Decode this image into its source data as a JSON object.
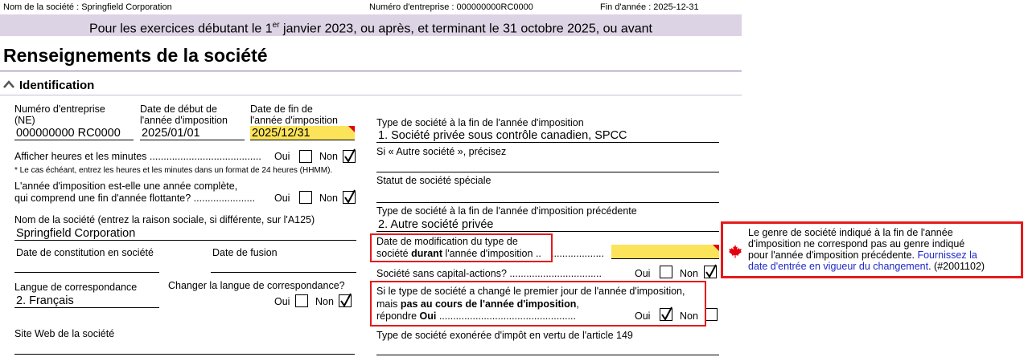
{
  "header": {
    "company_label": "Nom de la société : Springfield Corporation",
    "business_number_label": "Numéro d'entreprise : 000000000RC0000",
    "year_end_label": "Fin d'année : 2025-12-31"
  },
  "period_text_before": "Pour les exercices débutant le 1",
  "period_text_sup": "er",
  "period_text_after": " janvier 2023, ou après, et terminant le 31 octobre 2025, ou avant",
  "page_title": "Renseignements de la société",
  "section_title": "Identification",
  "left": {
    "ne_label_1": "Numéro d'entreprise",
    "ne_label_2": "(NE)",
    "ne_value": "000000000 RC0000",
    "start_label_1": "Date de début de",
    "start_label_2": "l'année d'imposition",
    "start_value": "2025/01/01",
    "end_label_1": "Date de fin de",
    "end_label_2": "l'année d'imposition",
    "end_value": "2025/12/31",
    "hours_label": "Afficher heures et les minutes ........................................",
    "hours_note": "* Le cas échéant, entrez les heures et les minutes dans un format de 24 heures (HHMM).",
    "full_year_label_1": "L'année d'imposition est-elle une année complète,",
    "full_year_label_2": "qui comprend une fin d'année flottante? ......................",
    "name_label": "Nom de la société (entrez la raison sociale, si différente, sur l'A125)",
    "name_value": "Springfield Corporation",
    "incorporation_label": "Date de constitution en société",
    "merger_label": "Date de fusion",
    "language_label": "Langue de correspondance",
    "language_value": "2. Français",
    "change_language_label": "Changer la langue de correspondance?",
    "website_label": "Site Web de la société",
    "oui": "Oui",
    "non": "Non"
  },
  "right": {
    "type_end_label": "Type de société à la fin de l'année d'imposition",
    "type_end_value": "1. Société privée sous contrôle canadien, SPCC",
    "other_label": "Si « Autre société », précisez",
    "special_label": "Statut de société spéciale",
    "type_prev_label": "Type de société à la fin de l'année d'imposition précédente",
    "type_prev_value": "2. Autre société privée",
    "mod_date_label_1": "Date de modification du type de",
    "mod_date_label_2a": "société ",
    "mod_date_label_2b": "durant",
    "mod_date_label_2c": " l'année d'imposition ..",
    "mod_date_dots": "...................",
    "no_share_label": "Société sans capital-actions? .................................",
    "changed_label_1": "Si le type de société a changé le premier jour de l'année d'imposition,",
    "changed_label_2a": "mais ",
    "changed_label_2b": "pas au cours de l'année d'imposition",
    "changed_label_2c": ",",
    "changed_label_3a": "répondre ",
    "changed_label_3b": "Oui",
    "changed_label_3c": " .................................................",
    "exempt_label": "Type de société exonérée d'impôt en vertu de l'article 149",
    "oui": "Oui",
    "non": "Non"
  },
  "tooltip": {
    "text_1": "Le genre de société indiqué à la fin de l'année",
    "text_2": "d'imposition ne correspond pas au genre indiqué",
    "text_3": "pour l'année d'imposition précédente. ",
    "link_1": "Fournissez la",
    "link_2": "date d'entrée en vigueur du changement",
    "code": ". (#2001102)"
  },
  "colors": {
    "period_band": "#dcd3e4",
    "highlight_yellow": "#fbe45a",
    "error_red": "#e31b1b",
    "link_blue": "#1f28c8"
  },
  "checkboxes": {
    "hours_oui": false,
    "hours_non": true,
    "full_year_oui": false,
    "full_year_non": true,
    "change_lang_oui": false,
    "change_lang_non": true,
    "no_share_oui": false,
    "no_share_non": true,
    "changed_oui": true,
    "changed_non": false
  }
}
